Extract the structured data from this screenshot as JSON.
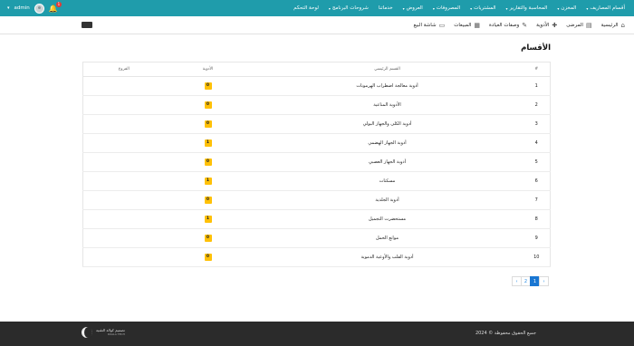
{
  "topnav": {
    "items": [
      {
        "label": "أقسام المصاريف",
        "caret": true
      },
      {
        "label": "المخزن",
        "caret": true
      },
      {
        "label": "المحاسبة والتقارير",
        "caret": true
      },
      {
        "label": "المشتريات",
        "caret": true
      },
      {
        "label": "المصروفات",
        "caret": true
      },
      {
        "label": "العروض",
        "caret": true
      },
      {
        "label": "خدماتنا",
        "caret": false
      },
      {
        "label": "شروحات البرنامج",
        "caret": true
      },
      {
        "label": "لوحة التحكم",
        "caret": false
      }
    ],
    "notifications": "1",
    "user": "admin"
  },
  "subnav": {
    "items": [
      {
        "label": "الرئيسية",
        "icon": "home-icon",
        "glyph": "⌂"
      },
      {
        "label": "المرضى",
        "icon": "patients-icon",
        "glyph": "▤"
      },
      {
        "label": "الأدوية",
        "icon": "medicine-icon",
        "glyph": "✚"
      },
      {
        "label": "وصفات العيادة",
        "icon": "prescription-icon",
        "glyph": "✎"
      },
      {
        "label": "المبيعات",
        "icon": "sales-icon",
        "glyph": "▦"
      },
      {
        "label": "شاشة البيع",
        "icon": "pos-icon",
        "glyph": "▭"
      }
    ]
  },
  "page": {
    "title": "الأقسام"
  },
  "table": {
    "headers": {
      "num": "#",
      "name": "القسم الرئيسي",
      "drugs": "الأدوية",
      "dependents": "الفروع"
    },
    "rows": [
      {
        "num": "1",
        "name": "أدوية معالجة اضطراب الهرمونات",
        "drugs": "0"
      },
      {
        "num": "2",
        "name": "الأدوية المناعية",
        "drugs": "0"
      },
      {
        "num": "3",
        "name": "أدوية الكلى والجهاز البولي",
        "drugs": "0"
      },
      {
        "num": "4",
        "name": "أدوية الجهاز الهضمي",
        "drugs": "1"
      },
      {
        "num": "5",
        "name": "أدوية الجهاز العصبي",
        "drugs": "0"
      },
      {
        "num": "6",
        "name": "مسكنات",
        "drugs": "1"
      },
      {
        "num": "7",
        "name": "أدوية الجلدية",
        "drugs": "0"
      },
      {
        "num": "8",
        "name": "مستحضرت التجميل",
        "drugs": "1"
      },
      {
        "num": "9",
        "name": "موانع الحمل",
        "drugs": "0"
      },
      {
        "num": "10",
        "name": "أدوية القلب والأوعية الدموية",
        "drugs": "0"
      }
    ]
  },
  "pagination": {
    "prev": "‹",
    "pages": [
      "1",
      "2"
    ],
    "active": "1",
    "next": "›"
  },
  "footer": {
    "copyright": "جميع الحقوق محفوظة © 2024",
    "brand": "تصميم كوالة التقنية",
    "brand_sub": "KOALA TECH"
  },
  "colors": {
    "primary": "#1f9cab",
    "badge": "#ffc107",
    "footer": "#2b2b2b",
    "active_page": "#1976d2"
  }
}
